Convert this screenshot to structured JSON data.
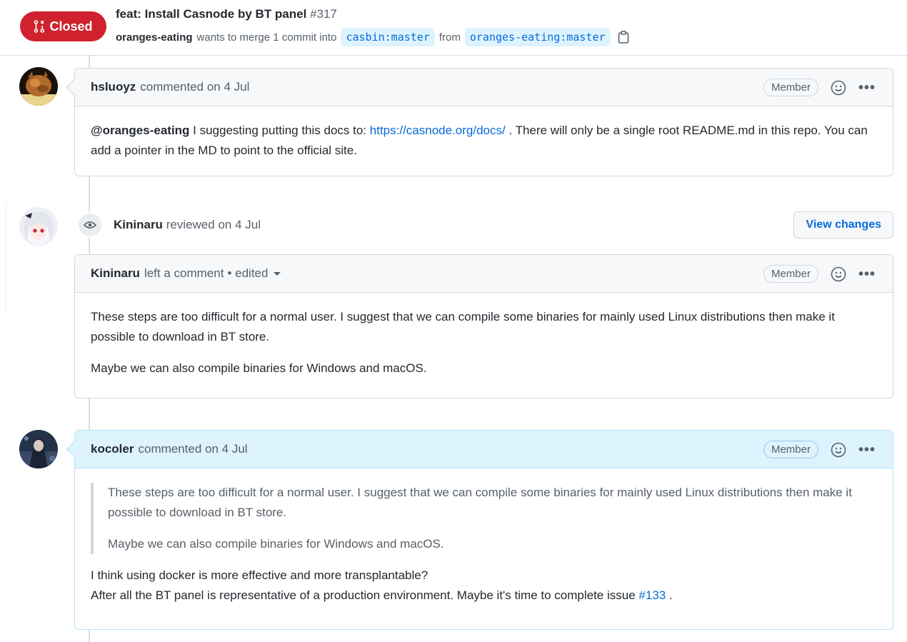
{
  "pr": {
    "state": "Closed",
    "title": "feat: Install Casnode by BT panel",
    "number": "#317",
    "author": "oranges-eating",
    "merge_text": "wants to merge 1 commit into",
    "base_branch": "casbin:master",
    "from_text": "from",
    "head_branch": "oranges-eating:master",
    "state_color": "#cf222e"
  },
  "comments": [
    {
      "user": "hsluoyz",
      "action": "commented on 4 Jul",
      "badge": "Member",
      "body": {
        "mention": "@oranges-eating",
        "text1": " I suggesting putting this docs to: ",
        "link": "https://casnode.org/docs/",
        "text2": " . There will only be a single root README.md in this repo. You can add a pointer in the MD to point to the official site."
      }
    },
    {
      "user": "Kininaru",
      "action": "left a comment",
      "edited": "• edited",
      "badge": "Member",
      "paragraphs": [
        "These steps are too difficult for a normal user. I suggest that we can compile some binaries for mainly used Linux distributions then make it possible to download in BT store.",
        "Maybe we can also compile binaries for Windows and macOS."
      ]
    },
    {
      "user": "kocoler",
      "action": "commented on 4 Jul",
      "badge": "Member",
      "quote": [
        "These steps are too difficult for a normal user. I suggest that we can compile some binaries for mainly used Linux distributions then make it possible to download in BT store.",
        "Maybe we can also compile binaries for Windows and macOS."
      ],
      "line1": "I think using docker is more effective and more transplantable?",
      "line2": "After all the BT panel is representative of a production environment. Maybe it's time to complete issue ",
      "issue_link": "#133",
      "line2_end": " ."
    }
  ],
  "review": {
    "user": "Kininaru",
    "action": "reviewed on 4 Jul",
    "button": "View changes"
  },
  "icons": {
    "state": "git-pull-request-closed-icon",
    "copy": "copy-icon",
    "emoji": "smiley-icon",
    "kebab": "kebab-horizontal-icon",
    "review": "eye-icon"
  },
  "colors": {
    "link": "#0969da",
    "accent_blue_bg": "#ddf4ff"
  }
}
